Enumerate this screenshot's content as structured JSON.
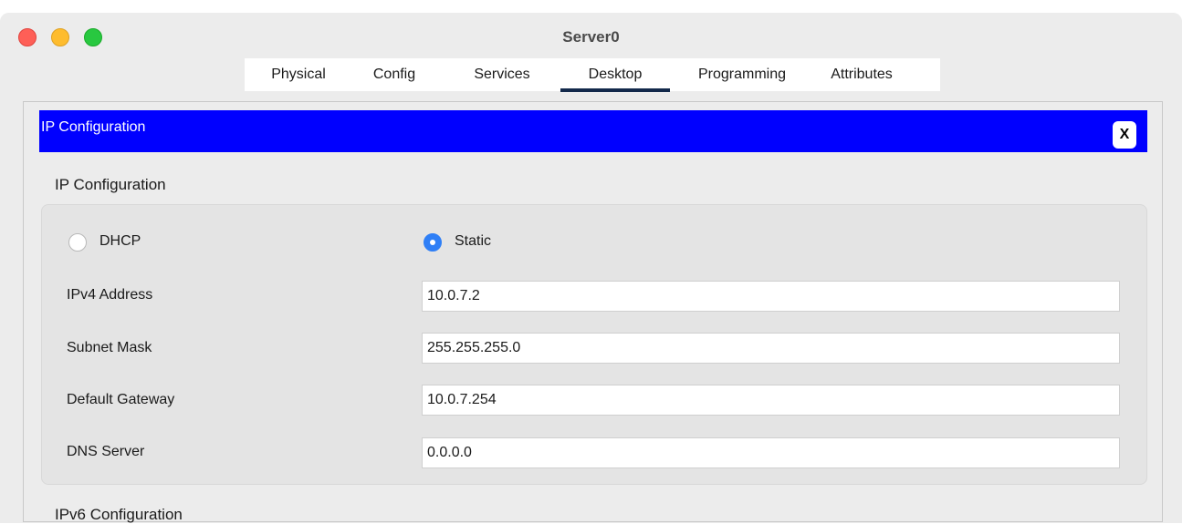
{
  "window": {
    "title": "Server0"
  },
  "tabs": [
    {
      "label": "Physical",
      "active": false
    },
    {
      "label": "Config",
      "active": false
    },
    {
      "label": "Services",
      "active": false
    },
    {
      "label": "Desktop",
      "active": true
    },
    {
      "label": "Programming",
      "active": false
    },
    {
      "label": "Attributes",
      "active": false
    }
  ],
  "panel": {
    "header_title": "IP Configuration",
    "close_label": "X"
  },
  "ipv4": {
    "section_title": "IP Configuration",
    "mode": "Static",
    "dhcp_label": "DHCP",
    "static_label": "Static",
    "fields": {
      "ipv4_address": {
        "label": "IPv4 Address",
        "value": "10.0.7.2"
      },
      "subnet_mask": {
        "label": "Subnet Mask",
        "value": "255.255.255.0"
      },
      "default_gateway": {
        "label": "Default Gateway",
        "value": "10.0.7.254"
      },
      "dns_server": {
        "label": "DNS Server",
        "value": "0.0.0.0"
      }
    }
  },
  "ipv6": {
    "section_title": "IPv6 Configuration"
  },
  "colors": {
    "header_blue": "#0000ff",
    "active_tab_underline": "#13294b",
    "radio_selected": "#2f7ff6"
  }
}
